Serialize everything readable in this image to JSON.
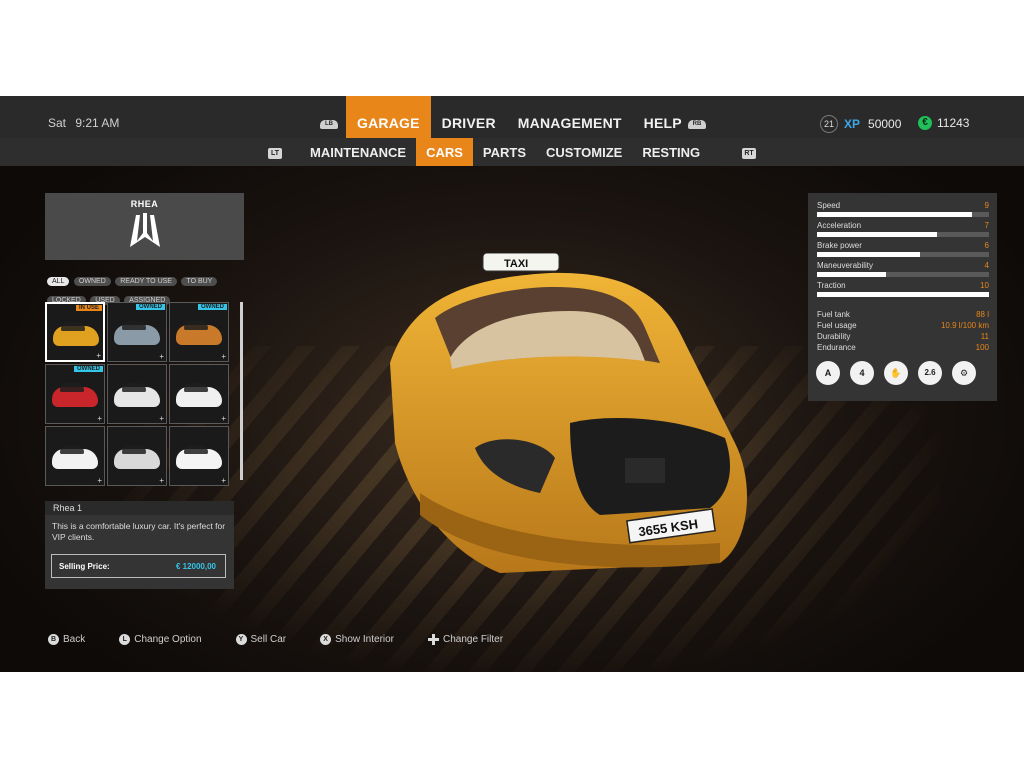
{
  "header": {
    "day": "Sat",
    "time": "9:21 AM",
    "lb_label": "LB",
    "rb_label": "RB",
    "tabs": [
      {
        "label": "GARAGE",
        "active": true
      },
      {
        "label": "DRIVER",
        "active": false
      },
      {
        "label": "MANAGEMENT",
        "active": false
      },
      {
        "label": "HELP",
        "active": false
      }
    ],
    "level": "21",
    "xp_label": "XP",
    "xp_value": "50000",
    "money": "11243",
    "accent_color": "#e8861a"
  },
  "subnav": {
    "lt_label": "LT",
    "rt_label": "RT",
    "tabs": [
      {
        "label": "MAINTENANCE",
        "active": false
      },
      {
        "label": "CARS",
        "active": true
      },
      {
        "label": "PARTS",
        "active": false
      },
      {
        "label": "CUSTOMIZE",
        "active": false
      },
      {
        "label": "RESTING",
        "active": false
      }
    ]
  },
  "brand": {
    "name": "RHEA"
  },
  "filters": [
    {
      "label": "ALL",
      "active": true
    },
    {
      "label": "OWNED",
      "active": false
    },
    {
      "label": "READY TO USE",
      "active": false
    },
    {
      "label": "TO BUY",
      "active": false
    },
    {
      "label": "LOCKED",
      "active": false
    },
    {
      "label": "USED",
      "active": false
    },
    {
      "label": "ASSIGNED",
      "active": false
    }
  ],
  "cars": [
    {
      "tag": "IN USE",
      "color": "#e0a020",
      "selected": true
    },
    {
      "tag": "OWNED",
      "color": "#8a9aa6",
      "selected": false
    },
    {
      "tag": "OWNED",
      "color": "#c87a2a",
      "selected": false
    },
    {
      "tag": "OWNED",
      "color": "#c8262a",
      "selected": false
    },
    {
      "tag": "",
      "color": "#e6e6e6",
      "selected": false
    },
    {
      "tag": "",
      "color": "#f0f0f0",
      "selected": false
    },
    {
      "tag": "",
      "color": "#f2f2f2",
      "selected": false
    },
    {
      "tag": "",
      "color": "#d8d8d8",
      "selected": false
    },
    {
      "tag": "",
      "color": "#f4f4f4",
      "selected": false
    }
  ],
  "selected_car": {
    "name": "Rhea 1",
    "description": "This is a comfortable luxury car. It's perfect for VIP clients.",
    "price_label": "Selling Price:",
    "price": "€ 12000,00",
    "plate": "3655 KSH",
    "roof_sign": "TAXI"
  },
  "stats": [
    {
      "label": "Speed",
      "value": 9,
      "max": 10
    },
    {
      "label": "Acceleration",
      "value": 7,
      "max": 10
    },
    {
      "label": "Brake power",
      "value": 6,
      "max": 10
    },
    {
      "label": "Maneuverability",
      "value": 4,
      "max": 10
    },
    {
      "label": "Traction",
      "value": 10,
      "max": 10
    }
  ],
  "specs": [
    {
      "label": "Fuel tank",
      "value": "88 l"
    },
    {
      "label": "Fuel usage",
      "value": "10.9 l/100 km"
    },
    {
      "label": "Durability",
      "value": "11"
    },
    {
      "label": "Endurance",
      "value": "100"
    }
  ],
  "feature_icons": [
    {
      "name": "automatic-gearbox-icon",
      "glyph": "A"
    },
    {
      "name": "four-seats-icon",
      "glyph": "4"
    },
    {
      "name": "comfort-icon",
      "glyph": "✋"
    },
    {
      "name": "weight-icon",
      "glyph": "2.6"
    },
    {
      "name": "engine-icon",
      "glyph": "⚙"
    }
  ],
  "prompts": [
    {
      "button": "B",
      "label": "Back"
    },
    {
      "button": "L",
      "label": "Change Option"
    },
    {
      "button": "Y",
      "label": "Sell Car"
    },
    {
      "button": "X",
      "label": "Show Interior"
    },
    {
      "button": "dpad",
      "label": "Change Filter"
    }
  ]
}
